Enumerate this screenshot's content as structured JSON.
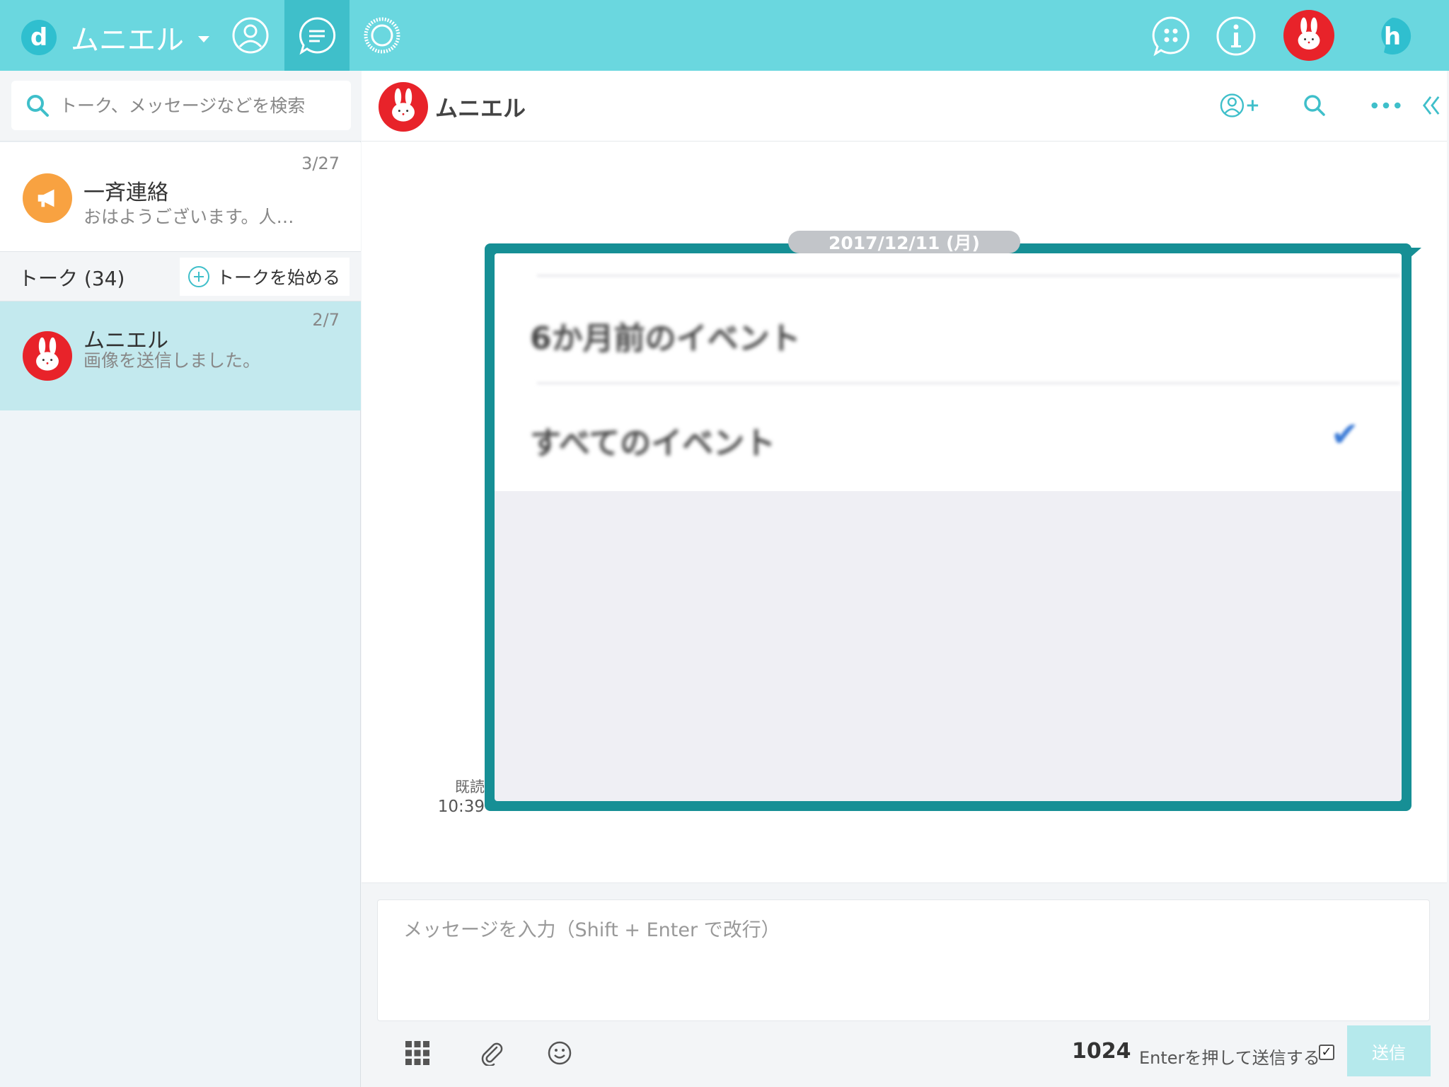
{
  "topbar": {
    "brand_letter": "d",
    "brand_name": "ムニエル",
    "right_avatar_letter": "h"
  },
  "sidebar": {
    "search_placeholder": "トーク、メッセージなどを検索",
    "broadcast": {
      "title": "一斉連絡",
      "preview": "おはようございます。人…",
      "date": "3/27"
    },
    "talk_count": "トーク (34)",
    "start_talk": "トークを始める",
    "talks": [
      {
        "title": "ムニエル",
        "preview": "画像を送信しました。",
        "date": "2/7"
      }
    ]
  },
  "chat": {
    "title": "ムニエル",
    "date_pill": "2017/12/11 (月)",
    "image_content": {
      "row1": "6か月前のイベント",
      "row2": "すべてのイベント"
    },
    "read_label": "既読",
    "read_time": "10:39"
  },
  "composer": {
    "placeholder": "メッセージを入力（Shift + Enter で改行）",
    "char_count": "1024",
    "enter_label": "Enterを押して送信する",
    "send_label": "送信"
  },
  "colors": {
    "topbar": "#6ad7df",
    "accent": "#3fbfca",
    "bubble_border": "#168f95",
    "rabbit_red": "#e8232a",
    "broadcast_orange": "#f8a241"
  }
}
